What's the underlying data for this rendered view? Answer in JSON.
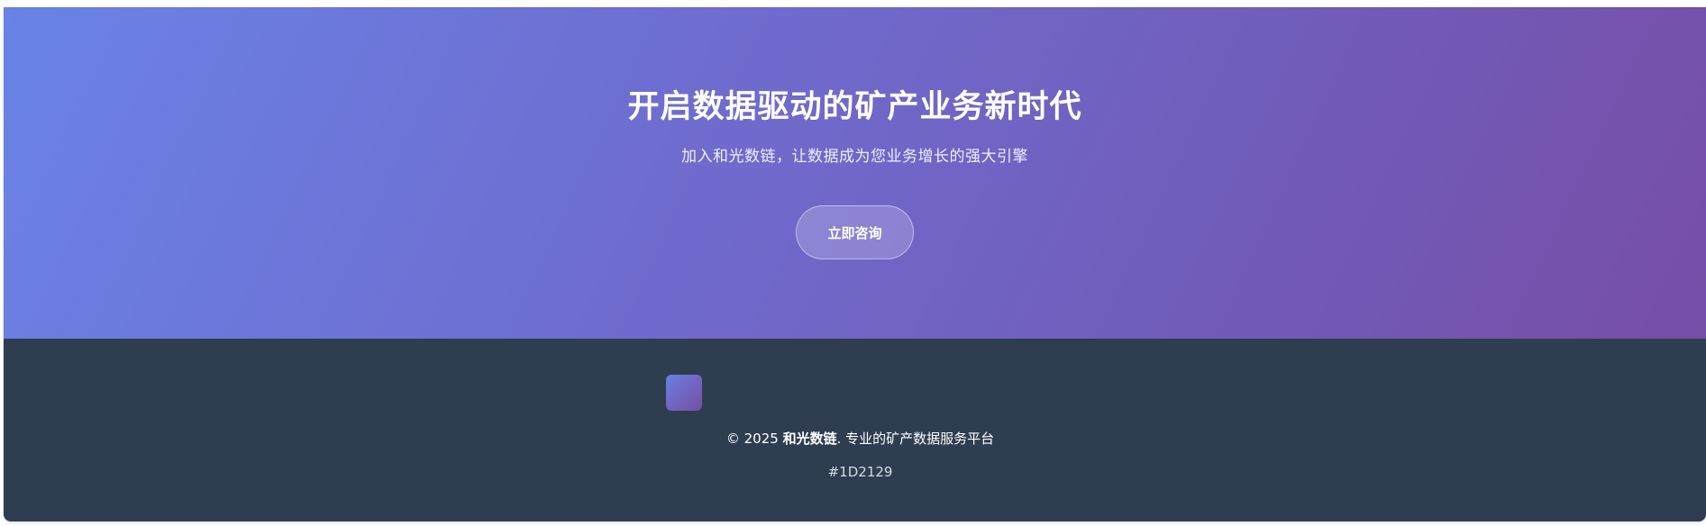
{
  "hero": {
    "title": "开启数据驱动的矿产业务新时代",
    "subtitle": "加入和光数链，让数据成为您业务增长的强大引擎",
    "cta_label": "立即咨询"
  },
  "footer": {
    "copyright_prefix": "© 2025 ",
    "brand": "和光数链",
    "copyright_suffix": ". 专业的矿产数据服务平台",
    "color_code": "#1D2129"
  },
  "colors": {
    "hero_gradient_start": "#6a83e6",
    "hero_gradient_end": "#774ea6",
    "footer_background": "#2e3e50"
  }
}
